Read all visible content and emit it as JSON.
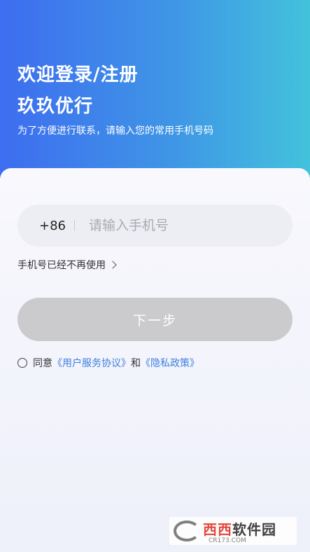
{
  "header": {
    "welcome": "欢迎登录/注册",
    "brand": "玖玖优行",
    "subtitle": "为了方便进行联系，请输入您的常用手机号码"
  },
  "phone": {
    "country_code": "+86",
    "placeholder": "请输入手机号",
    "value": ""
  },
  "unused_link": "手机号已经不再使用",
  "next_button": "下一步",
  "agreement": {
    "prefix": "同意",
    "terms": "《用户服务协议》",
    "and": "和",
    "privacy": "《隐私政策》"
  },
  "watermark": {
    "main": "西西",
    "main2": "软件园",
    "sub": "CR173.COM"
  },
  "colors": {
    "gradient_start": "#3d6df0",
    "gradient_end": "#43c2dc",
    "link": "#3d7fe0",
    "button_disabled": "#cbcbcd"
  }
}
